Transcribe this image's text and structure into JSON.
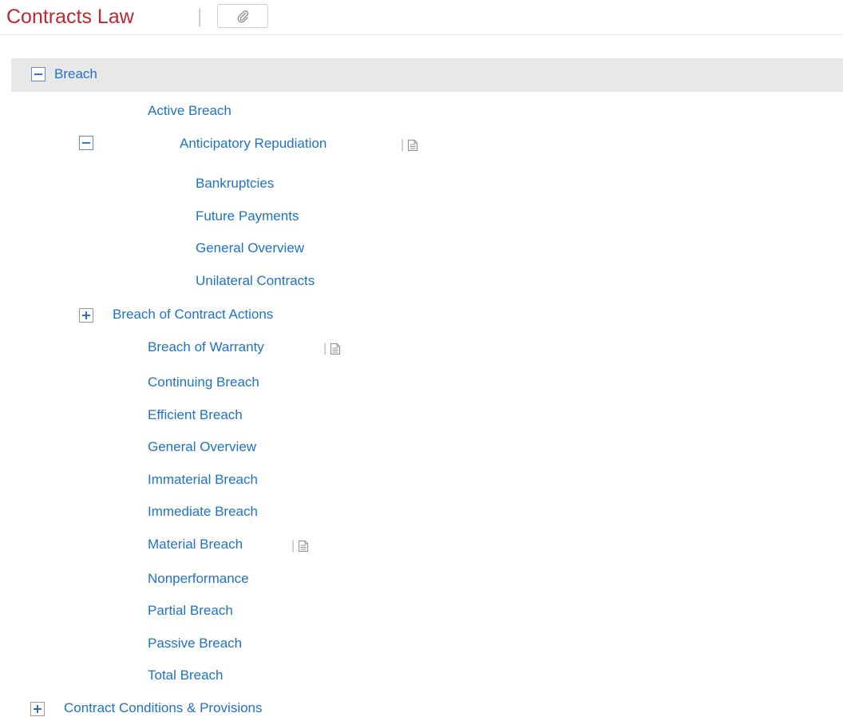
{
  "header": {
    "title": "Contracts Law",
    "separator": "|",
    "link_icon": "paperclip-icon"
  },
  "tree": {
    "breach": "Breach",
    "active_breach": "Active Breach",
    "anticipatory_repudiation": "Anticipatory Repudiation",
    "bankruptcies": "Bankruptcies",
    "future_payments": "Future Payments",
    "general_overview_ar": "General Overview",
    "unilateral_contracts": "Unilateral Contracts",
    "breach_of_contract_actions": "Breach of Contract Actions",
    "breach_of_warranty": "Breach of Warranty",
    "continuing_breach": "Continuing Breach",
    "efficient_breach": "Efficient Breach",
    "general_overview": "General Overview",
    "immaterial_breach": "Immaterial Breach",
    "immediate_breach": "Immediate Breach",
    "material_breach": "Material Breach",
    "nonperformance": "Nonperformance",
    "partial_breach": "Partial Breach",
    "passive_breach": "Passive Breach",
    "total_breach": "Total Breach",
    "contract_conditions": "Contract Conditions & Provisions"
  },
  "marker_separator": "|",
  "icons": {
    "collapse": "minus-box-icon",
    "expand": "plus-box-icon",
    "document": "document-icon"
  },
  "colors": {
    "title": "#c0272d",
    "link": "#1f72c4",
    "selected_row": "#e8e8e8"
  }
}
